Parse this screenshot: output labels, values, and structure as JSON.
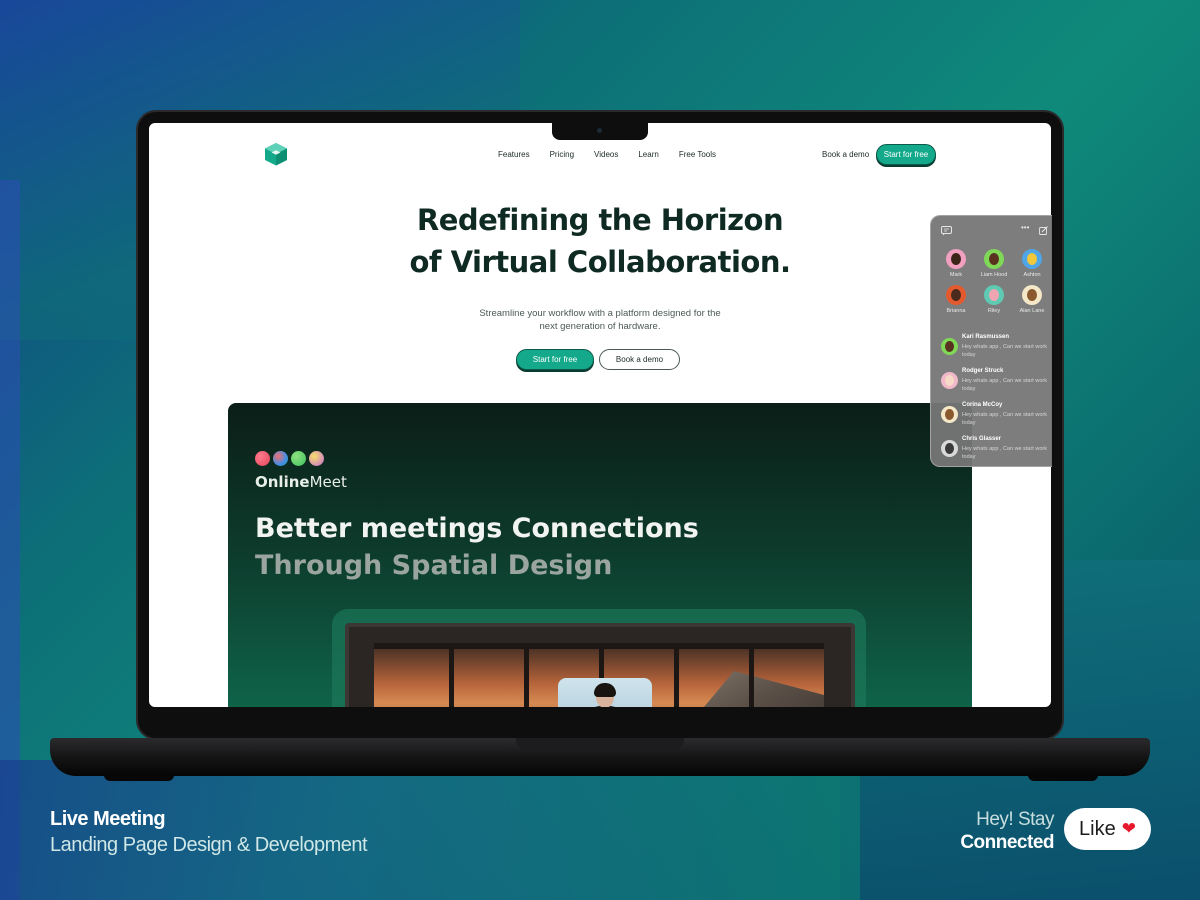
{
  "site": {
    "nav_items": [
      "Features",
      "Pricing",
      "Videos",
      "Learn",
      "Free Tools"
    ],
    "book_demo": "Book a demo",
    "start_free": "Start for free",
    "accent_color": "#13a98a"
  },
  "hero": {
    "title_line1": "Redefining the Horizon",
    "title_line2": "of Virtual Collaboration.",
    "subtitle": "Streamline your workflow with a platform designed for the next generation of hardware.",
    "primary_button": "Start for free",
    "secondary_button": "Book a demo"
  },
  "card": {
    "brand_bold": "Online",
    "brand_light": "Meet",
    "headline_line1": "Better meetings Connections",
    "headline_line2": "Through Spatial Design",
    "dot_colors": [
      "#e0445a",
      "#3f8fe8",
      "#3cbf5e",
      "#e7c23c"
    ]
  },
  "chat": {
    "top_icons": [
      "chat-icon",
      "more-icon",
      "edit-icon"
    ],
    "avatars": [
      "Mark",
      "Liam Hood",
      "Ashton",
      "Brianna",
      "Riley",
      "Alan Lane"
    ],
    "messages": [
      {
        "name": "Kari Rasmussen",
        "text_line1": "Hey whats app , Can we start work",
        "text_line2": "today"
      },
      {
        "name": "Rodger Struck",
        "text_line1": "Hey whats app , Can we start work",
        "text_line2": "today"
      },
      {
        "name": "Corina McCoy",
        "text_line1": "Hey whats app , Can we start work",
        "text_line2": "today"
      },
      {
        "name": "Chris Glasser",
        "text_line1": "Hey whats app , Can we start work",
        "text_line2": "today"
      }
    ]
  },
  "captions": {
    "left_title": "Live Meeting",
    "left_subtitle": "Landing Page Design & Development",
    "right_line1": "Hey! Stay",
    "right_line2": "Connected",
    "like_label": "Like"
  }
}
